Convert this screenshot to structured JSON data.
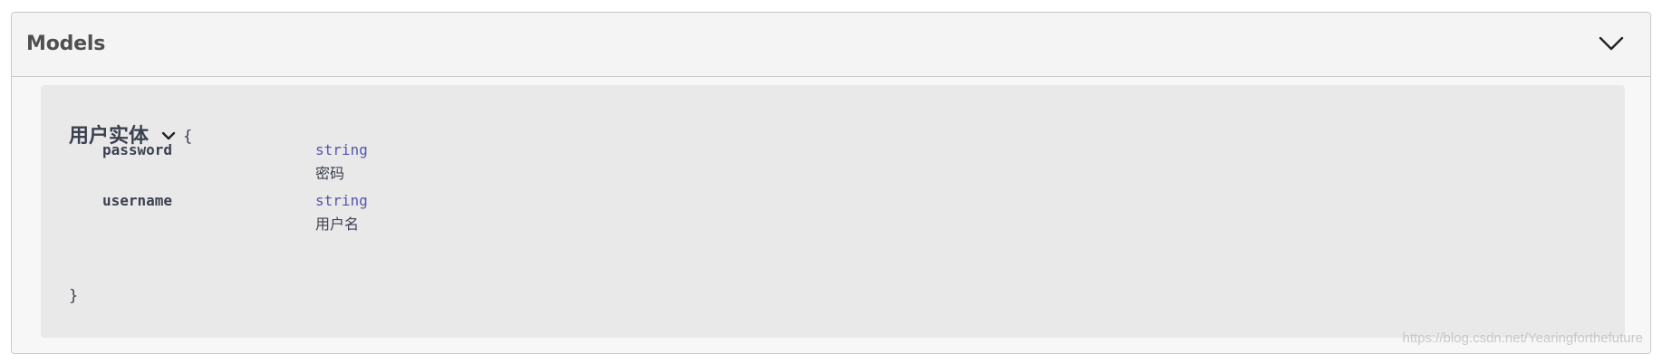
{
  "models": {
    "title": "Models"
  },
  "model": {
    "name": "用户实体",
    "open_brace": "{",
    "close_brace": "}",
    "properties": [
      {
        "name": "password",
        "type": "string",
        "description": "密码"
      },
      {
        "name": "username",
        "type": "string",
        "description": "用户名"
      }
    ]
  },
  "watermark": "https://blog.csdn.net/Yearingforthefuture",
  "icons": {
    "collapse": "chevron-down-icon",
    "expand": "chevron-down-icon"
  },
  "colors": {
    "type_color": "#5555aa",
    "text_color": "#3b4151",
    "header_title": "#505050"
  }
}
